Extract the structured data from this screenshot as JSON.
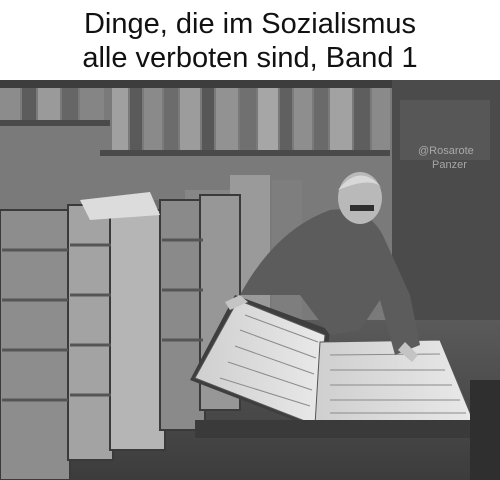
{
  "caption": {
    "line1": "Dinge, die im Sozialismus",
    "line2": "alle verboten sind, Band 1"
  },
  "photo": {
    "style": "black-and-white vintage photograph",
    "watermark_line1": "@Rosarote",
    "watermark_line2": "Panzer"
  }
}
